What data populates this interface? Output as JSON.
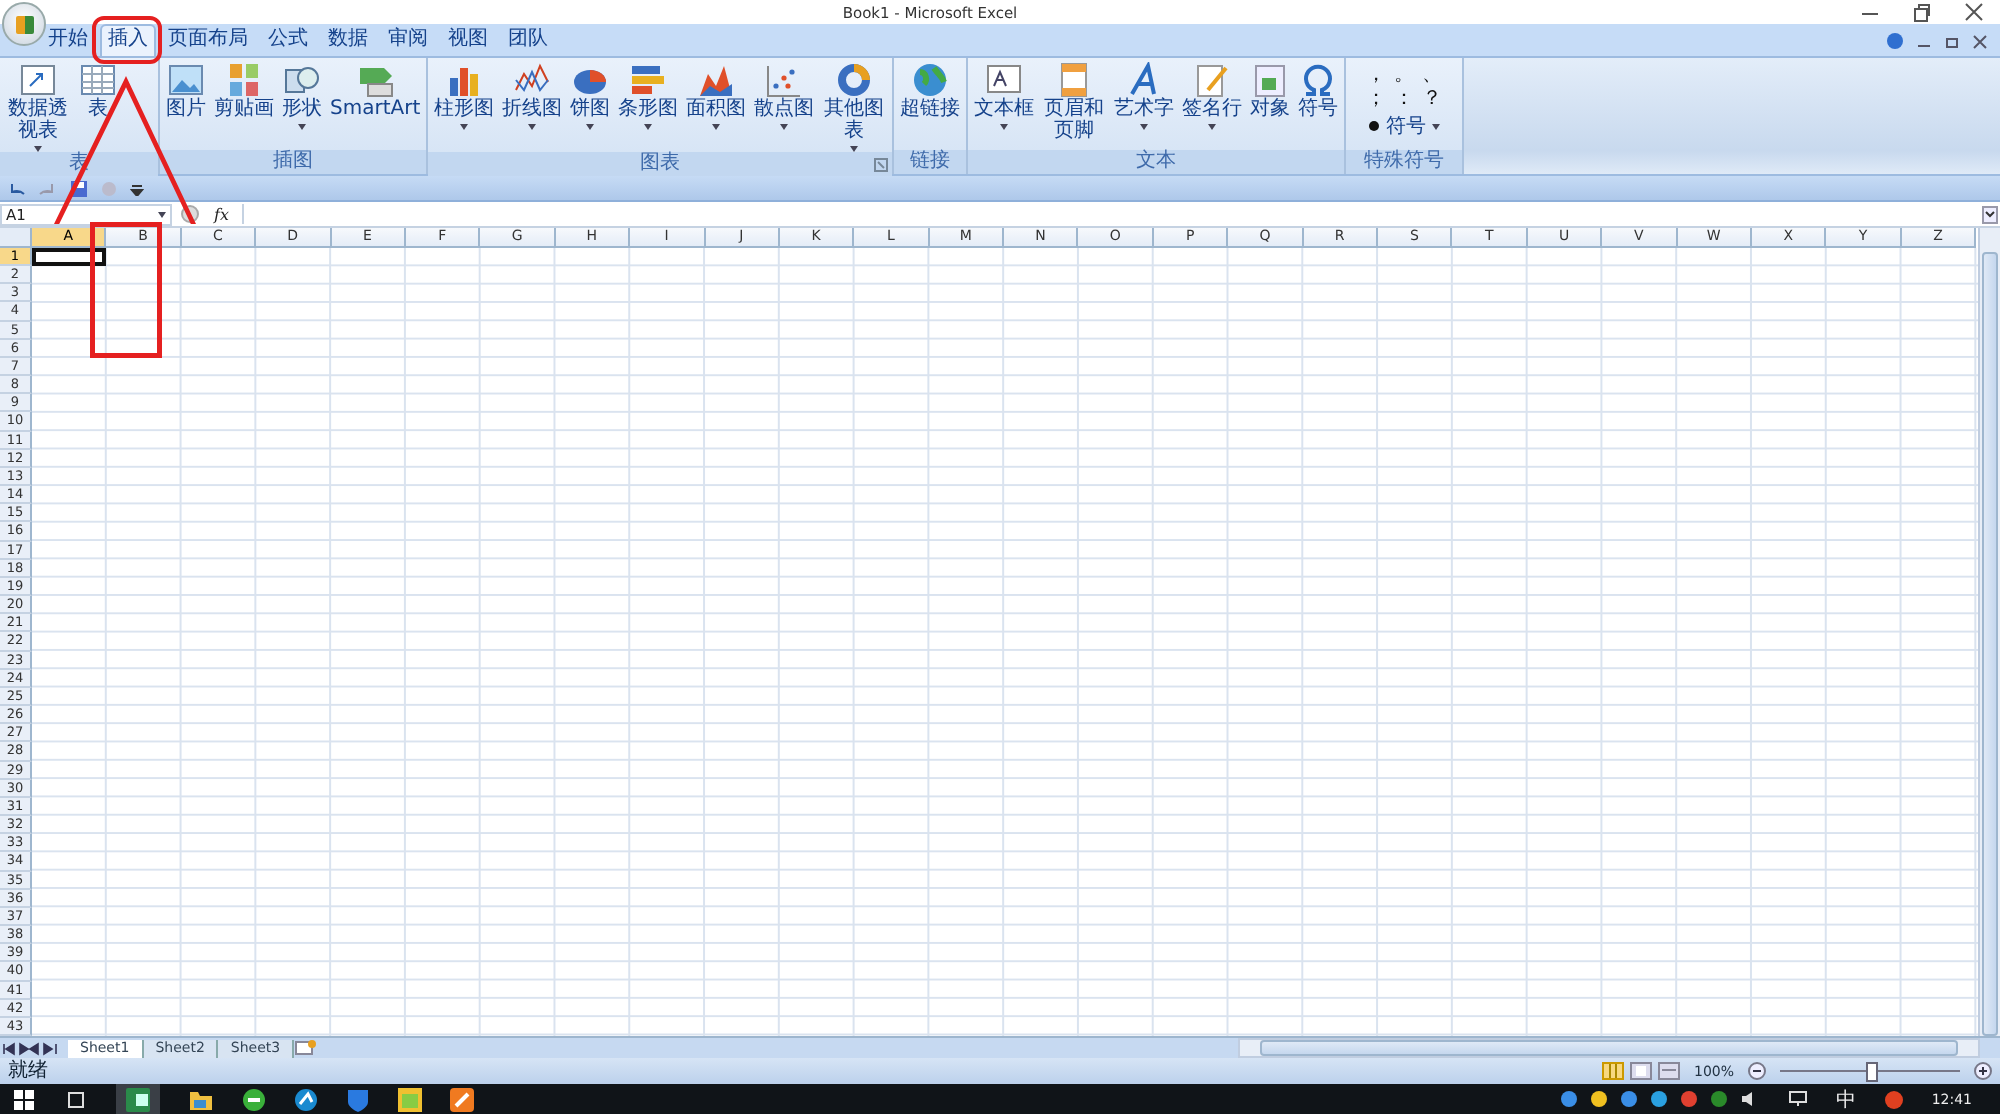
{
  "window": {
    "title": "Book1 - Microsoft Excel"
  },
  "tabs": [
    {
      "label": "开始",
      "selected": false
    },
    {
      "label": "插入",
      "selected": true
    },
    {
      "label": "页面布局",
      "selected": false
    },
    {
      "label": "公式",
      "selected": false
    },
    {
      "label": "数据",
      "selected": false
    },
    {
      "label": "审阅",
      "selected": false
    },
    {
      "label": "视图",
      "selected": false
    },
    {
      "label": "团队",
      "selected": false
    }
  ],
  "ribbon": {
    "groups": [
      {
        "label": "表",
        "launcher": false,
        "buttons": [
          {
            "label": "数据透视表",
            "dropdown": true
          },
          {
            "label": "表",
            "dropdown": false
          }
        ]
      },
      {
        "label": "插图",
        "launcher": false,
        "buttons": [
          {
            "label": "图片",
            "dropdown": false
          },
          {
            "label": "剪贴画",
            "dropdown": false
          },
          {
            "label": "形状",
            "dropdown": true
          },
          {
            "label": "SmartArt",
            "dropdown": false
          }
        ]
      },
      {
        "label": "图表",
        "launcher": true,
        "buttons": [
          {
            "label": "柱形图",
            "dropdown": true
          },
          {
            "label": "折线图",
            "dropdown": true
          },
          {
            "label": "饼图",
            "dropdown": true
          },
          {
            "label": "条形图",
            "dropdown": true
          },
          {
            "label": "面积图",
            "dropdown": true
          },
          {
            "label": "散点图",
            "dropdown": true
          },
          {
            "label": "其他图表",
            "dropdown": true
          }
        ]
      },
      {
        "label": "链接",
        "launcher": false,
        "buttons": [
          {
            "label": "超链接",
            "dropdown": false
          }
        ]
      },
      {
        "label": "文本",
        "launcher": false,
        "buttons": [
          {
            "label": "文本框",
            "dropdown": true
          },
          {
            "label": "页眉和页脚",
            "dropdown": false
          },
          {
            "label": "艺术字",
            "dropdown": true
          },
          {
            "label": "签名行",
            "dropdown": true
          },
          {
            "label": "对象",
            "dropdown": false
          },
          {
            "label": "符号",
            "dropdown": false
          }
        ]
      }
    ],
    "special_symbols": {
      "label": "特殊符号",
      "symbols": [
        "，",
        "。",
        "、",
        "；",
        "：",
        "？"
      ],
      "button": {
        "label": "符号",
        "dropdown": true
      }
    }
  },
  "formula_bar": {
    "name_box": "A1",
    "function_label": "fx"
  },
  "sheet": {
    "columns": [
      {
        "label": "A",
        "selected": true
      },
      {
        "label": "B",
        "selected": false
      },
      {
        "label": "C",
        "selected": false
      },
      {
        "label": "D",
        "selected": false
      },
      {
        "label": "E",
        "selected": false
      },
      {
        "label": "F",
        "selected": false
      },
      {
        "label": "G",
        "selected": false
      },
      {
        "label": "H",
        "selected": false
      },
      {
        "label": "I",
        "selected": false
      },
      {
        "label": "J",
        "selected": false
      },
      {
        "label": "K",
        "selected": false
      },
      {
        "label": "L",
        "selected": false
      },
      {
        "label": "M",
        "selected": false
      },
      {
        "label": "N",
        "selected": false
      },
      {
        "label": "O",
        "selected": false
      },
      {
        "label": "P",
        "selected": false
      },
      {
        "label": "Q",
        "selected": false
      },
      {
        "label": "R",
        "selected": false
      },
      {
        "label": "S",
        "selected": false
      },
      {
        "label": "T",
        "selected": false
      },
      {
        "label": "U",
        "selected": false
      },
      {
        "label": "V",
        "selected": false
      },
      {
        "label": "W",
        "selected": false
      },
      {
        "label": "X",
        "selected": false
      },
      {
        "label": "Y",
        "selected": false
      },
      {
        "label": "Z",
        "selected": false
      }
    ],
    "rows": [
      "1",
      "2",
      "3",
      "4",
      "5",
      "6",
      "7",
      "8",
      "9",
      "10",
      "11",
      "12",
      "13",
      "14",
      "15",
      "16",
      "17",
      "18",
      "19",
      "20",
      "21",
      "22",
      "23",
      "24",
      "25",
      "26",
      "27",
      "28",
      "29",
      "30",
      "31",
      "32",
      "33",
      "34",
      "35",
      "36",
      "37",
      "38",
      "39",
      "40",
      "41",
      "42",
      "43"
    ]
  },
  "sheet_tabs": [
    {
      "label": "Sheet1",
      "selected": true
    },
    {
      "label": "Sheet2",
      "selected": false
    },
    {
      "label": "Sheet3",
      "selected": false
    }
  ],
  "status_bar": {
    "text": "就绪",
    "zoom": "100%",
    "zoom_slider": {
      "level": 0.5
    }
  },
  "taskbar": {
    "input_method": "中",
    "time": "12:41"
  }
}
